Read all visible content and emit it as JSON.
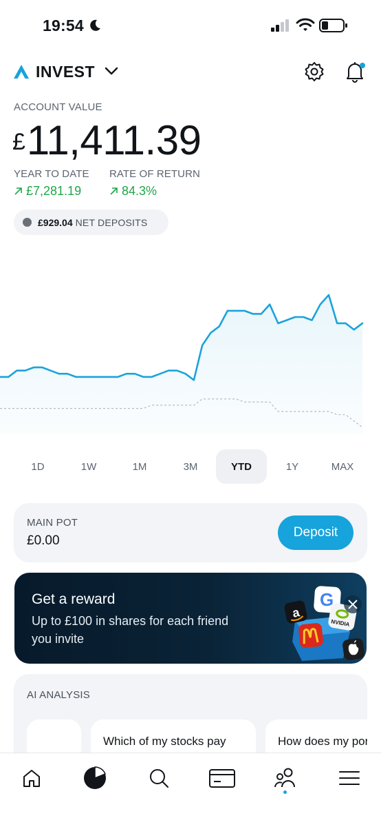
{
  "status_bar": {
    "time": "19:54"
  },
  "header": {
    "brand": "INVEST"
  },
  "account": {
    "label": "ACCOUNT VALUE",
    "currency": "£",
    "value": "11,411.39",
    "ytd_label": "YEAR TO DATE",
    "ytd_value": "£7,281.19",
    "ror_label": "RATE OF RETURN",
    "ror_value": "84.3%",
    "net_deposits_amount": "£929.04",
    "net_deposits_label": "NET DEPOSITS"
  },
  "chart_data": {
    "type": "line",
    "series": [
      {
        "values": [
          10,
          10,
          12,
          12,
          13,
          13,
          12,
          11,
          11,
          10,
          10,
          10,
          10,
          10,
          10,
          11,
          11,
          10,
          10,
          11,
          12,
          12,
          11,
          9,
          20,
          24,
          26,
          31,
          31,
          31,
          30,
          30,
          33,
          27,
          28,
          29,
          29,
          28,
          33,
          36,
          27,
          27,
          25,
          27
        ]
      },
      {
        "values": [
          0,
          0,
          0,
          0,
          0,
          0,
          0,
          0,
          0,
          0,
          0,
          0,
          0,
          0,
          0,
          0,
          0,
          0,
          1,
          1,
          1,
          1,
          1,
          1,
          3,
          3,
          3,
          3,
          3,
          2,
          2,
          2,
          2,
          -1,
          -1,
          -1,
          -1,
          -1,
          -1,
          -1,
          -2,
          -2,
          -4,
          -6
        ]
      }
    ],
    "colors": {
      "portfolio": "#1ba3da",
      "deposits": "#b4b9bf"
    }
  },
  "periods": [
    {
      "label": "1D",
      "active": false
    },
    {
      "label": "1W",
      "active": false
    },
    {
      "label": "1M",
      "active": false
    },
    {
      "label": "3M",
      "active": false
    },
    {
      "label": "YTD",
      "active": true
    },
    {
      "label": "1Y",
      "active": false
    },
    {
      "label": "MAX",
      "active": false
    }
  ],
  "main_pot": {
    "label": "MAIN POT",
    "value": "£0.00",
    "button": "Deposit"
  },
  "reward": {
    "title": "Get a reward",
    "subtitle": "Up to £100 in shares for each friend you invite",
    "tile_label": "NVIDIA"
  },
  "ai": {
    "label": "AI ANALYSIS",
    "questions": [
      "Which of my stocks pay dividends?",
      "How does my portfolio compare to the"
    ]
  },
  "bottom_nav": [
    "home-icon",
    "portfolio-icon",
    "search-icon",
    "card-icon",
    "community-icon",
    "menu-icon"
  ],
  "colors": {
    "accent": "#17a3dc",
    "positive": "#1fa64a",
    "banner": "#0a2336"
  }
}
